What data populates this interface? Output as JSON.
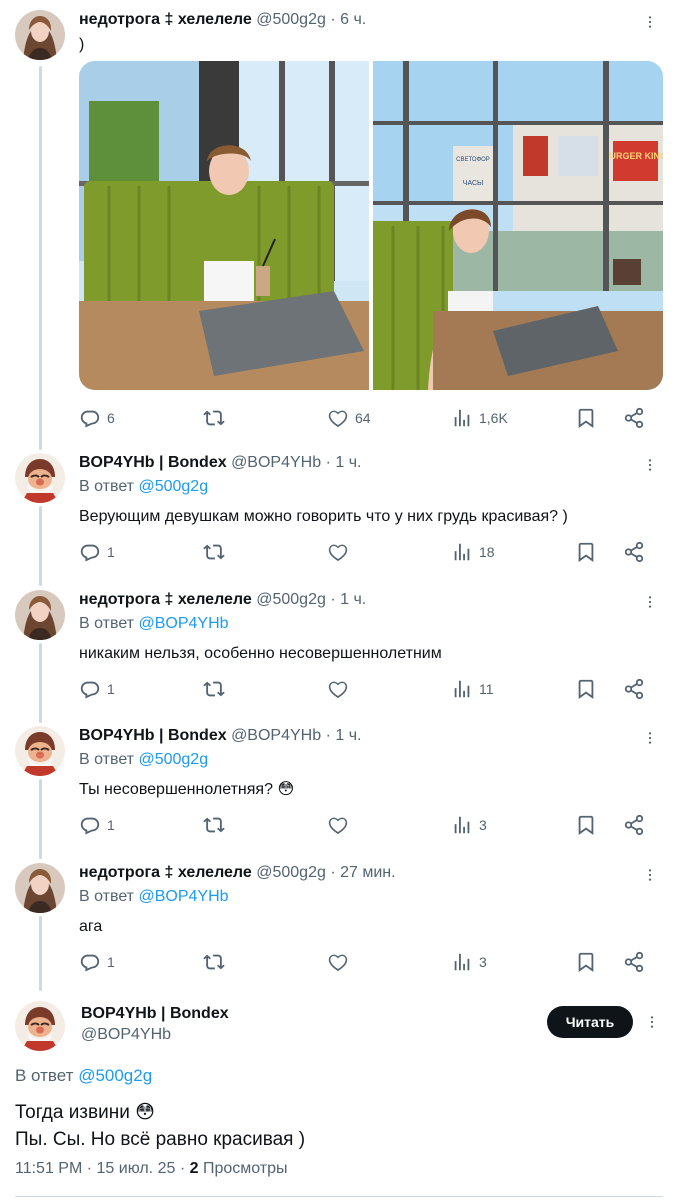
{
  "tweets": [
    {
      "name": "недотрога ‡ хелелеле",
      "handle": "@500g2g",
      "time": "6 ч.",
      "text": ")",
      "replies": "6",
      "likes": "64",
      "views": "1,6K"
    },
    {
      "name": "BOP4YHb | Bondex",
      "handle": "@BOP4YHb",
      "time": "1 ч.",
      "reply_prefix": "В ответ",
      "reply_mention": "@500g2g",
      "text": "Верующим девушкам можно говорить что у них грудь красивая? )",
      "replies": "1",
      "views": "18"
    },
    {
      "name": "недотрога ‡ хелелеле",
      "handle": "@500g2g",
      "time": "1 ч.",
      "reply_prefix": "В ответ",
      "reply_mention": "@BOP4YHb",
      "text": "никаким нельзя, особенно несовершеннолетним",
      "replies": "1",
      "views": "11"
    },
    {
      "name": "BOP4YHb | Bondex",
      "handle": "@BOP4YHb",
      "time": "1 ч.",
      "reply_prefix": "В ответ",
      "reply_mention": "@500g2g",
      "text": "Ты несовершеннолетняя? 😳",
      "replies": "1",
      "views": "3"
    },
    {
      "name": "недотрога ‡ хелелеле",
      "handle": "@500g2g",
      "time": "27 мин.",
      "reply_prefix": "В ответ",
      "reply_mention": "@BOP4YHb",
      "text": "ага",
      "replies": "1",
      "views": "3"
    }
  ],
  "main": {
    "name": "BOP4YHb | Bondex",
    "handle": "@BOP4YHb",
    "follow_label": "Читать",
    "reply_prefix": "В ответ",
    "reply_mention": "@500g2g",
    "line1": "Тогда извини 😳",
    "line2": "Пы. Сы. Но всё равно красивая )",
    "time": "11:51 PM · 15 июл. 25 · ",
    "views_count": "2",
    "views_label": " Просмотры"
  },
  "photo_signs": [
    "СВЕТОФОР",
    "ЧАСЫ",
    "BURGER KING"
  ],
  "icons": [
    "reply-icon",
    "repost-icon",
    "like-icon",
    "views-icon",
    "bookmark-icon",
    "share-icon",
    "more-icon"
  ],
  "colors": {
    "text": "#0f1419",
    "secondary": "#536471",
    "accent": "#1d9bf0",
    "line": "#cfd9de"
  }
}
